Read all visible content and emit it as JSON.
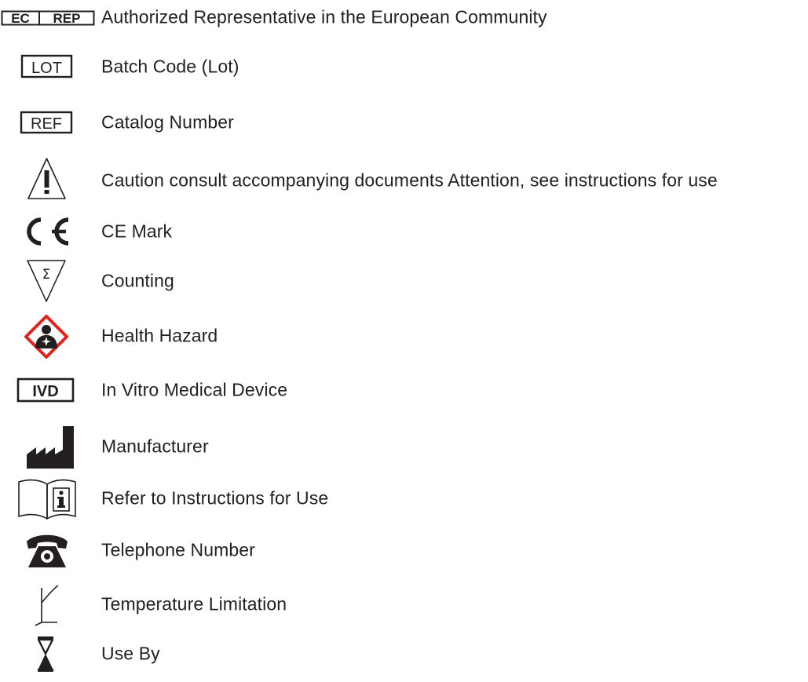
{
  "symbols": [
    {
      "icon": "ec-rep-icon",
      "box_text": [
        "EC",
        "REP"
      ],
      "label": "Authorized Representative in the European Community"
    },
    {
      "icon": "lot-icon",
      "box_text": "LOT",
      "label": "Batch Code (Lot)"
    },
    {
      "icon": "ref-icon",
      "box_text": "REF",
      "label": "Catalog Number"
    },
    {
      "icon": "caution-triangle-icon",
      "label": "Caution consult accompanying documents Attention, see instructions for use"
    },
    {
      "icon": "ce-mark-icon",
      "label": "CE Mark"
    },
    {
      "icon": "sigma-triangle-icon",
      "label": "Counting"
    },
    {
      "icon": "health-hazard-icon",
      "label": "Health Hazard"
    },
    {
      "icon": "ivd-icon",
      "box_text": "IVD",
      "label": "In Vitro Medical Device"
    },
    {
      "icon": "factory-icon",
      "label": "Manufacturer"
    },
    {
      "icon": "book-info-icon",
      "label": "Refer to Instructions for Use"
    },
    {
      "icon": "telephone-icon",
      "label": "Telephone Number"
    },
    {
      "icon": "thermometer-icon",
      "label": "Temperature Limitation"
    },
    {
      "icon": "hourglass-icon",
      "label": "Use By"
    }
  ],
  "colors": {
    "text": "#231f20",
    "hazard_red": "#e2231a"
  }
}
